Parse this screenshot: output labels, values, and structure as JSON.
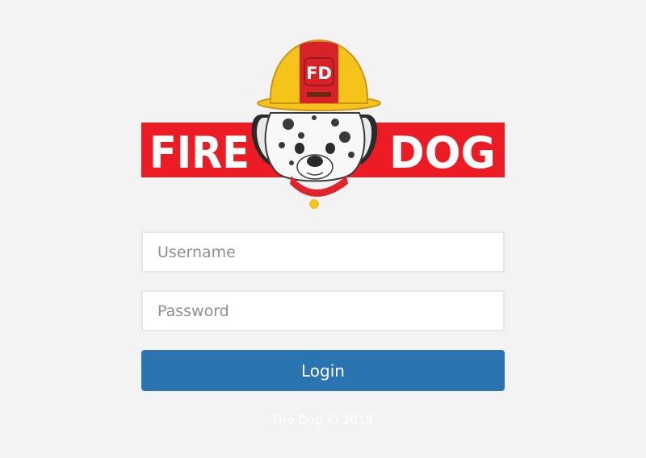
{
  "logo": {
    "word_left": "FIRE",
    "word_right": "DOG",
    "helmet_badge": "FD",
    "colors": {
      "banner_red": "#ed1c24",
      "helmet_yellow": "#f6c31b",
      "helmet_red": "#d8222a",
      "text_white": "#ffffff"
    }
  },
  "form": {
    "username_placeholder": "Username",
    "password_placeholder": "Password",
    "login_label": "Login"
  },
  "footer": {
    "text": "Fire Dog © 2018"
  },
  "colors": {
    "background": "#f3f3f4",
    "button_blue": "#2a74b2",
    "field_border": "#e5e6e7"
  }
}
